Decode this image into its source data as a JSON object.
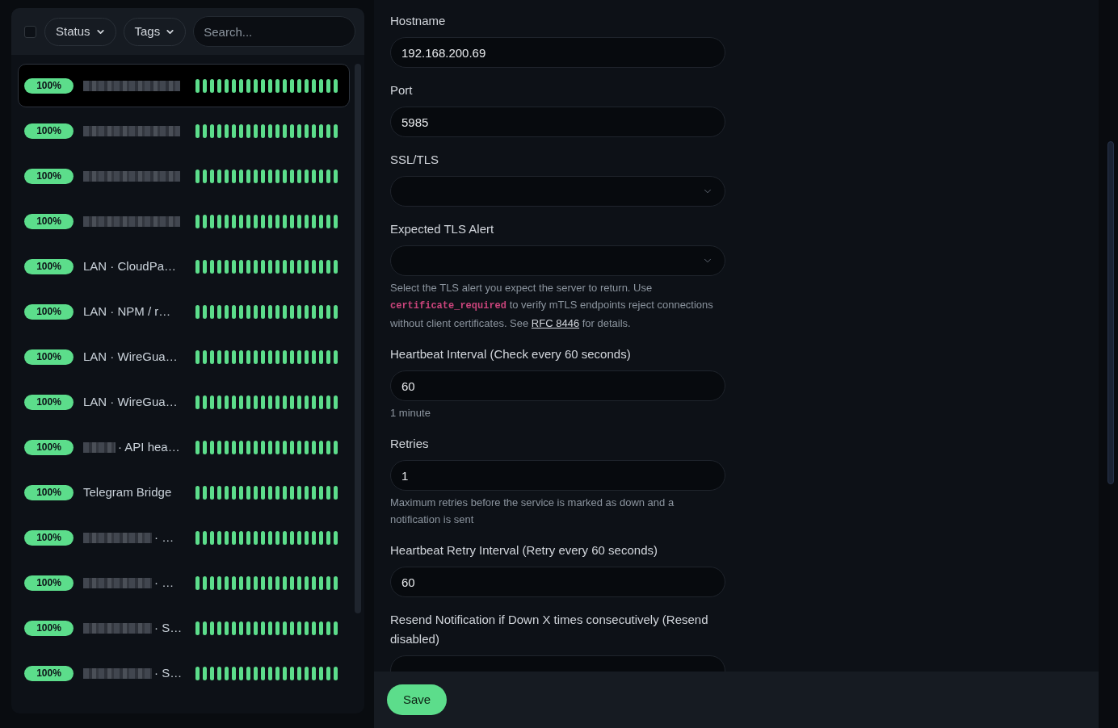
{
  "filters": {
    "select_all": {
      "checked": false
    },
    "buttons": [
      {
        "label": "Status"
      },
      {
        "label": "Tags"
      }
    ],
    "search": {
      "placeholder": "Search..."
    }
  },
  "monitors": [
    {
      "kind": "masked",
      "uptime": "100%",
      "selected": true,
      "up": true
    },
    {
      "kind": "masked",
      "uptime": "100%",
      "selected": false,
      "up": true
    },
    {
      "kind": "masked",
      "uptime": "100%",
      "selected": false,
      "up": true
    },
    {
      "kind": "masked",
      "uptime": "100%",
      "selected": false,
      "up": true
    },
    {
      "kind": "plain",
      "uptime": "100%",
      "selected": false,
      "up": true,
      "name": "LAN · CloudPa…"
    },
    {
      "kind": "plain",
      "uptime": "100%",
      "selected": false,
      "up": true,
      "name": "LAN · NPM / r…"
    },
    {
      "kind": "plain",
      "uptime": "100%",
      "selected": false,
      "up": true,
      "name": "LAN · WireGua…"
    },
    {
      "kind": "plain",
      "uptime": "100%",
      "selected": false,
      "up": true,
      "name": "LAN · WireGua…"
    },
    {
      "kind": "tagged",
      "uptime": "100%",
      "selected": false,
      "up": true,
      "name": "· API hea…"
    },
    {
      "kind": "plain",
      "uptime": "100%",
      "selected": false,
      "up": true,
      "name": "Telegram Bridge"
    },
    {
      "kind": "prefixed",
      "uptime": "100%",
      "selected": false,
      "up": true,
      "name": "· …"
    },
    {
      "kind": "prefixed",
      "uptime": "100%",
      "selected": false,
      "up": true,
      "name": "· …"
    },
    {
      "kind": "prefixed",
      "uptime": "100%",
      "selected": false,
      "up": true,
      "name": "· S…"
    },
    {
      "kind": "prefixed",
      "uptime": "100%",
      "selected": false,
      "up": true,
      "name": "· S…"
    }
  ],
  "form": {
    "fields": [
      {
        "kind": "input",
        "label": "Hostname",
        "value": "192.168.200.69"
      },
      {
        "kind": "input",
        "label": "Port",
        "value": "5985"
      },
      {
        "kind": "select",
        "label": "SSL/TLS"
      },
      {
        "kind": "select",
        "label": "Expected TLS Alert",
        "help": [
          {
            "kind": "text",
            "text": "Select the TLS alert you expect the server to return. Use "
          },
          {
            "kind": "code",
            "text": "certificate_required"
          },
          {
            "kind": "text",
            "text": " to verify mTLS endpoints reject connections without client certificates. See "
          },
          {
            "kind": "link",
            "text": "RFC 8446"
          },
          {
            "kind": "text",
            "text": " for details."
          }
        ]
      },
      {
        "kind": "input",
        "label": "Heartbeat Interval (Check every 60 seconds)",
        "value": "60",
        "help": [
          {
            "kind": "text",
            "text": "1 minute"
          }
        ]
      },
      {
        "kind": "input",
        "label": "Retries",
        "value": "1",
        "help": [
          {
            "kind": "text",
            "text": "Maximum retries before the service is marked as down and a notification is sent"
          }
        ]
      },
      {
        "kind": "input",
        "label": "Heartbeat Retry Interval (Retry every 60 seconds)",
        "value": "60"
      },
      {
        "kind": "input",
        "label": "Resend Notification if Down X times consecutively (Resend disabled)"
      }
    ],
    "save_button": "Save"
  }
}
